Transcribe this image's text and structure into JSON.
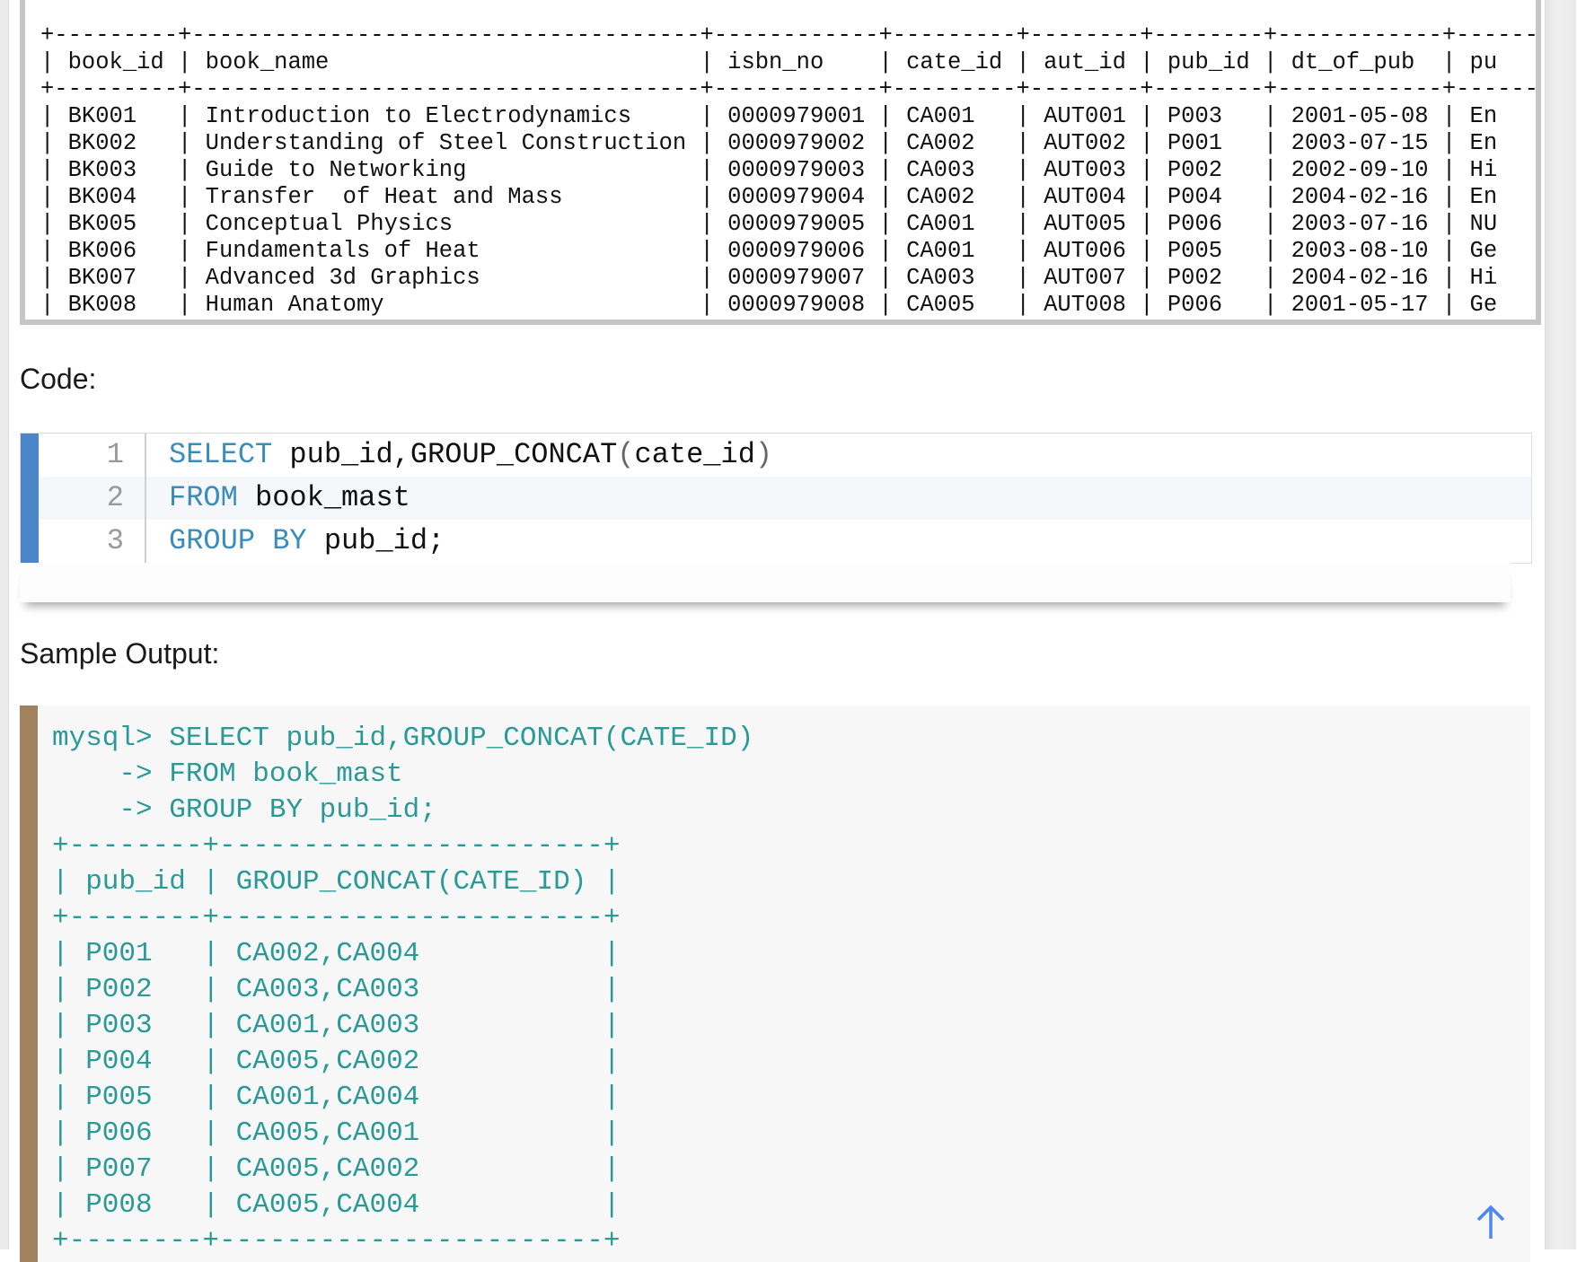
{
  "top_table": {
    "headers": [
      "book_id",
      "book_name",
      "isbn_no",
      "cate_id",
      "aut_id",
      "pub_id",
      "dt_of_pub",
      "pu"
    ],
    "rows": [
      [
        "BK001",
        "Introduction to Electrodynamics",
        "0000979001",
        "CA001",
        "AUT001",
        "P003",
        "2001-05-08",
        "En"
      ],
      [
        "BK002",
        "Understanding of Steel Construction",
        "0000979002",
        "CA002",
        "AUT002",
        "P001",
        "2003-07-15",
        "En"
      ],
      [
        "BK003",
        "Guide to Networking",
        "0000979003",
        "CA003",
        "AUT003",
        "P002",
        "2002-09-10",
        "Hi"
      ],
      [
        "BK004",
        "Transfer  of Heat and Mass",
        "0000979004",
        "CA002",
        "AUT004",
        "P004",
        "2004-02-16",
        "En"
      ],
      [
        "BK005",
        "Conceptual Physics",
        "0000979005",
        "CA001",
        "AUT005",
        "P006",
        "2003-07-16",
        "NU"
      ],
      [
        "BK006",
        "Fundamentals of Heat",
        "0000979006",
        "CA001",
        "AUT006",
        "P005",
        "2003-08-10",
        "Ge"
      ],
      [
        "BK007",
        "Advanced 3d Graphics",
        "0000979007",
        "CA003",
        "AUT007",
        "P002",
        "2004-02-16",
        "Hi"
      ],
      [
        "BK008",
        "Human Anatomy",
        "0000979008",
        "CA005",
        "AUT008",
        "P006",
        "2001-05-17",
        "Ge"
      ]
    ],
    "widths": [
      9,
      37,
      12,
      9,
      8,
      8,
      12,
      6
    ]
  },
  "code_heading": "Code:",
  "code": {
    "lines": [
      {
        "num": "1",
        "kw": "SELECT",
        "rest": " pub_id,GROUP_CONCAT",
        "p1": "(",
        "arg": "cate_id",
        "p2": ")"
      },
      {
        "num": "2",
        "kw": "FROM",
        "rest": " book_mast"
      },
      {
        "num": "3",
        "kw": "GROUP BY",
        "rest": " pub_id;"
      }
    ]
  },
  "output_heading": "Sample Output:",
  "output": {
    "prompt_lines": [
      "mysql> SELECT pub_id,GROUP_CONCAT(CATE_ID)",
      "    -> FROM book_mast",
      "    -> GROUP BY pub_id;"
    ],
    "headers": [
      "pub_id",
      "GROUP_CONCAT(CATE_ID)"
    ],
    "rows": [
      [
        "P001",
        "CA002,CA004"
      ],
      [
        "P002",
        "CA003,CA003"
      ],
      [
        "P003",
        "CA001,CA003"
      ],
      [
        "P004",
        "CA005,CA002"
      ],
      [
        "P005",
        "CA001,CA004"
      ],
      [
        "P006",
        "CA005,CA001"
      ],
      [
        "P007",
        "CA005,CA002"
      ],
      [
        "P008",
        "CA005,CA004"
      ]
    ]
  },
  "icons": {
    "scroll_top": "arrow-up-icon"
  },
  "colors": {
    "keyword": "#3a8cbd",
    "output_text": "#2a9a98",
    "code_bar": "#4a86c8",
    "output_bar": "#a0825e",
    "arrow": "#4f86f0"
  }
}
